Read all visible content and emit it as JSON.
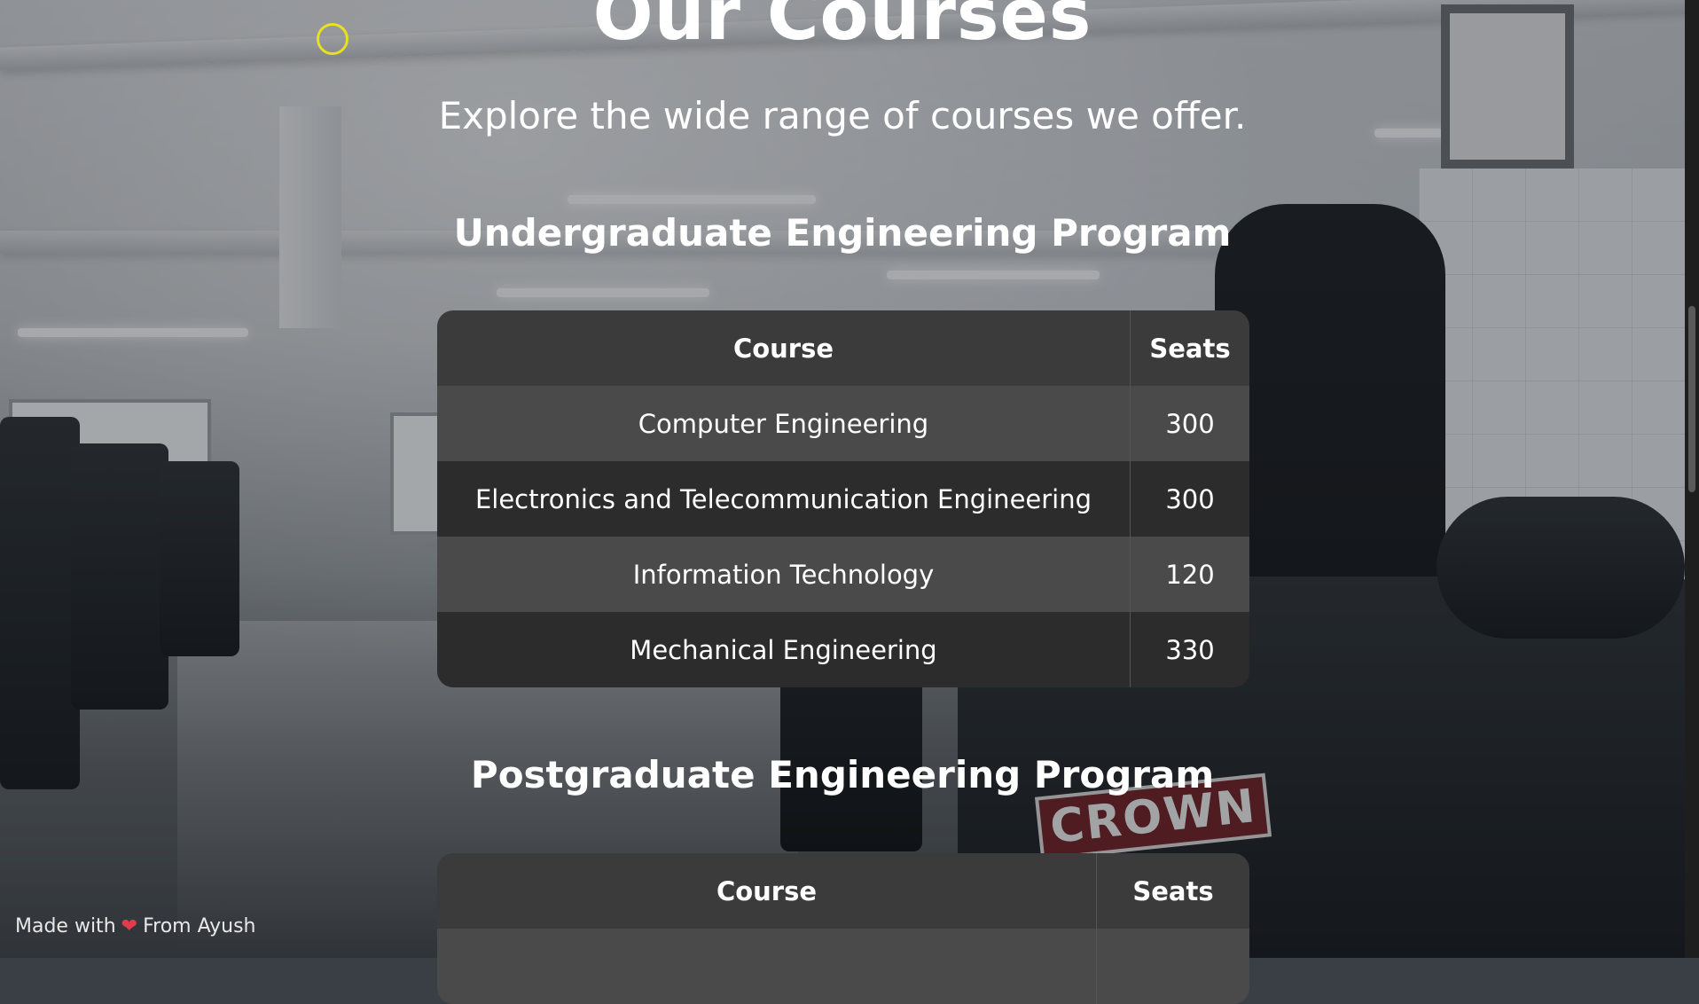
{
  "page": {
    "title": "Our Courses",
    "subtitle": "Explore the wide range of courses we offer."
  },
  "undergraduate": {
    "heading": "Undergraduate Engineering Program",
    "columns": [
      "Course",
      "Seats"
    ],
    "rows": [
      {
        "course": "Computer Engineering",
        "seats": "300"
      },
      {
        "course": "Electronics and Telecommunication Engineering",
        "seats": "300"
      },
      {
        "course": "Information Technology",
        "seats": "120"
      },
      {
        "course": "Mechanical Engineering",
        "seats": "330"
      }
    ]
  },
  "postgraduate": {
    "heading": "Postgraduate Engineering Program",
    "columns": [
      "Course",
      "Seats"
    ]
  },
  "footer": {
    "made_with": "Made with",
    "icon": "heart-icon",
    "from": "From Ayush"
  },
  "background": {
    "sign_text": "CROWN"
  },
  "colors": {
    "cursor_ring": "#e8e020",
    "heart": "#e23b4a",
    "table_header": "#3b3b3b",
    "row_light": "#4a4a4a",
    "row_dark": "#2c2c2c"
  }
}
